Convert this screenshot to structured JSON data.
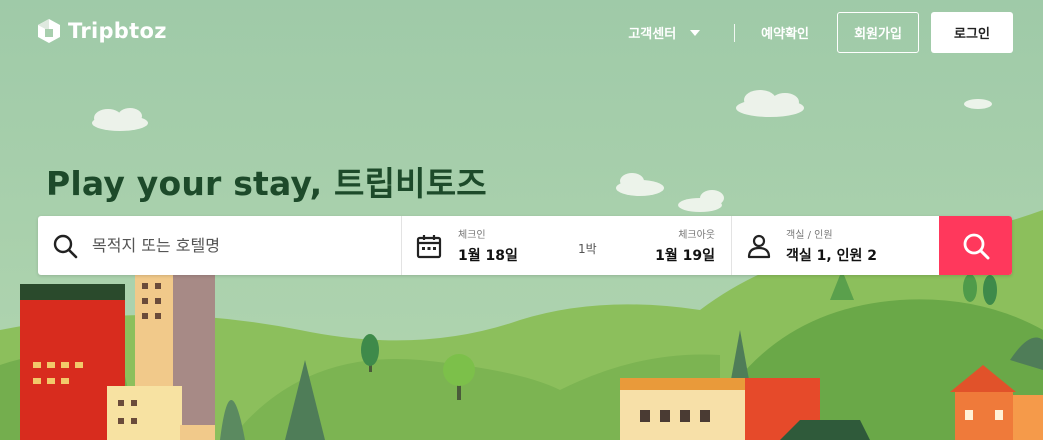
{
  "brand": {
    "name": "Tripbtoz"
  },
  "nav": {
    "support_label": "고객센터",
    "reservation_label": "예약확인",
    "signup_label": "회원가입",
    "login_label": "로그인"
  },
  "hero": {
    "headline": "Play your stay, 트립비토즈"
  },
  "search": {
    "destination_placeholder": "목적지 또는 호텔명",
    "checkin_label": "체크인",
    "checkin_value": "1월 18일",
    "nights_label": "1박",
    "checkout_label": "체크아웃",
    "checkout_value": "1월 19일",
    "guests_label": "객실 / 인원",
    "guests_value": "객실 1, 인원 2"
  },
  "colors": {
    "sky": "#a8cfae",
    "headline": "#1d4a2a",
    "search_button": "#ff385c",
    "hill_light": "#8cbf5c",
    "hill_dark": "#6aa848"
  },
  "icons": {
    "logo": "tripbtoz-logo-icon",
    "search": "search-icon",
    "calendar": "calendar-icon",
    "guests": "person-icon",
    "dropdown": "chevron-down-icon"
  }
}
